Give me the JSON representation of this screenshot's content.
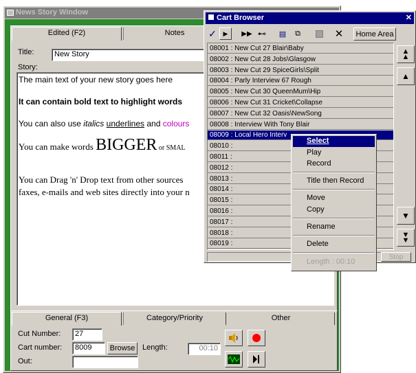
{
  "news": {
    "title": "News Story Window",
    "tab_edited": "Edited (F2)",
    "tab_notes": "Notes",
    "title_label": "Title:",
    "title_value": "New Story",
    "story_label": "Story:",
    "story": {
      "line1": "The main text of your new story goes here",
      "line2": "It can contain bold text to highlight words",
      "line3_a": "You can also use ",
      "line3_italic": "italics",
      "line3_sp": " ",
      "line3_underline": "underlines",
      "line3_and": " and ",
      "line3_colour": "colours",
      "line4_a": "You can make words ",
      "line4_big": "BIGGER",
      "line4_b": " or SMAL",
      "line5": "You can Drag 'n' Drop text from other sources",
      "line6": "faxes, e-mails and web sites directly into your n"
    },
    "bottom_tabs": [
      "General (F3)",
      "Category/Priority",
      "Other"
    ],
    "cut_number_label": "Cut Number:",
    "cut_number_value": "27",
    "cart_number_label": "Cart number:",
    "cart_number_value": "8009",
    "browse_label": "Browse",
    "length_label": "Length:",
    "length_value": "00:10",
    "out_label": "Out:",
    "out_value": "",
    "colors": {
      "record": "#ff0000",
      "wave": "#00c000"
    }
  },
  "cart": {
    "title": "Cart Browser",
    "home_area_label": "Home Area",
    "rows": [
      "08001 : New Cut 27 Blair\\Baby",
      "08002 : New Cut 28 Jobs\\Glasgow",
      "08003 : New Cut 29 SpiceGirls\\Split",
      "08004 : Parly Interview 67 Rough",
      "08005 : New Cut 30 QueenMum\\Hip",
      "08006 : New Cut 31 Cricket\\Collapse",
      "08007 : New Cut 32 Oasis\\NewSong",
      "08008 : Interview With Tony Blair",
      "08009 : Local Hero Interv",
      "08010 :",
      "08011 :",
      "08012 :",
      "08013 :",
      "08014 :",
      "08015 :",
      "08016 :",
      "08017 :",
      "08018 :",
      "08019 :"
    ],
    "selected_index": 8,
    "stop_label": "Stop"
  },
  "menu": {
    "select": "Select",
    "play": "Play",
    "record": "Record",
    "title_then_record": "Title then Record",
    "move": "Move",
    "copy": "Copy",
    "rename": "Rename",
    "delete": "Delete",
    "length": "Length : 00:10"
  }
}
